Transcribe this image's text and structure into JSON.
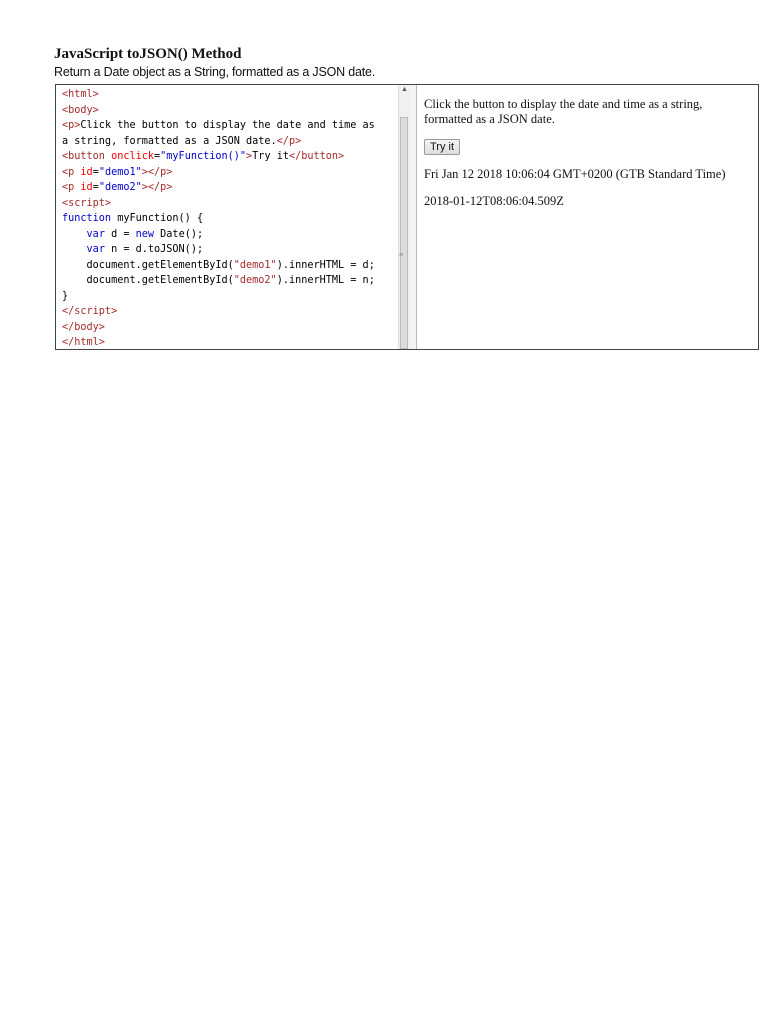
{
  "title": "JavaScript toJSON() Method",
  "subtitle": "Return a Date object as a String, formatted as a JSON date.",
  "code_lines": [
    [
      [
        "tag",
        "<html>"
      ]
    ],
    [
      [
        "tag",
        "<body>"
      ]
    ],
    [
      [
        "tag",
        "<p>"
      ],
      [
        "txt",
        "Click the button to display the date and time as"
      ]
    ],
    [
      [
        "txt",
        "a string, formatted as a JSON date."
      ],
      [
        "tag",
        "</p>"
      ]
    ],
    [
      [
        "tag",
        "<button "
      ],
      [
        "attr",
        "onclick"
      ],
      [
        "txt",
        "="
      ],
      [
        "val",
        "\"myFunction()\""
      ],
      [
        "tag",
        ">"
      ],
      [
        "txt",
        "Try it"
      ],
      [
        "tag",
        "</button>"
      ]
    ],
    [
      [
        "tag",
        "<p "
      ],
      [
        "attr",
        "id"
      ],
      [
        "txt",
        "="
      ],
      [
        "val",
        "\"demo1\""
      ],
      [
        "tag",
        "></p>"
      ]
    ],
    [
      [
        "tag",
        "<p "
      ],
      [
        "attr",
        "id"
      ],
      [
        "txt",
        "="
      ],
      [
        "val",
        "\"demo2\""
      ],
      [
        "tag",
        "></p>"
      ]
    ],
    [
      [
        "tag",
        "<script>"
      ]
    ],
    [
      [
        "kw",
        "function"
      ],
      [
        "txt",
        " myFunction() {"
      ]
    ],
    [
      [
        "txt",
        "    "
      ],
      [
        "kw",
        "var"
      ],
      [
        "txt",
        " d = "
      ],
      [
        "kw",
        "new"
      ],
      [
        "txt",
        " Date();"
      ]
    ],
    [
      [
        "txt",
        "    "
      ],
      [
        "kw",
        "var"
      ],
      [
        "txt",
        " n = d.toJSON();"
      ]
    ],
    [
      [
        "txt",
        "    document.getElementById("
      ],
      [
        "str",
        "\"demo1\""
      ],
      [
        "txt",
        ").innerHTML = d;"
      ]
    ],
    [
      [
        "txt",
        "    document.getElementById("
      ],
      [
        "str",
        "\"demo2\""
      ],
      [
        "txt",
        ").innerHTML = n;"
      ]
    ],
    [
      [
        "txt",
        "}"
      ]
    ],
    [
      [
        "tag",
        "</script>"
      ]
    ],
    [
      [
        "tag",
        "</body>"
      ]
    ],
    [
      [
        "tag",
        "</html>"
      ]
    ]
  ],
  "result": {
    "paragraph": "Click the button to display the date and time as a string, formatted as a JSON date.",
    "button_label": "Try it",
    "demo1": "Fri Jan 12 2018 10:06:04 GMT+0200 (GTB Standard Time)",
    "demo2": "2018-01-12T08:06:04.509Z"
  }
}
